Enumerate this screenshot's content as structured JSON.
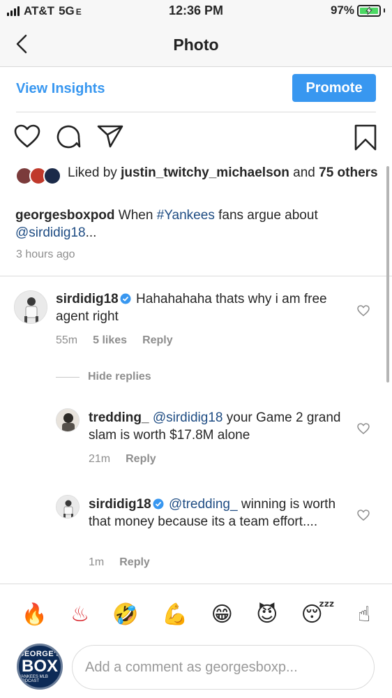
{
  "status_bar": {
    "carrier": "AT&T",
    "network": "5G",
    "network_suffix": "E",
    "time": "12:36 PM",
    "battery": "97%"
  },
  "nav": {
    "title": "Photo",
    "back_icon": "chevron-left-icon"
  },
  "insights": {
    "view_insights_label": "View Insights",
    "promote_label": "Promote"
  },
  "actions": {
    "icons": [
      "heart-icon",
      "comment-icon",
      "share-icon",
      "bookmark-icon"
    ]
  },
  "likes": {
    "prefix": "Liked by",
    "user": "justin_twitchy_michaelson",
    "joiner": "and",
    "others": "75 others"
  },
  "caption": {
    "user": "georgesboxpod",
    "text_1": "When",
    "hashtag": "#Yankees",
    "text_2": "fans argue about",
    "mention": "@sirdidig18",
    "text_3": "...",
    "time": "3 hours ago"
  },
  "comments": [
    {
      "user": "sirdidig18",
      "verified": true,
      "text": "Hahahahaha thats why i am free agent right",
      "time": "55m",
      "likes": "5 likes",
      "reply": "Reply"
    }
  ],
  "hide_replies_label": "Hide replies",
  "replies": [
    {
      "user": "tredding_",
      "verified": false,
      "mention": "@sirdidig18",
      "text": "your Game 2 grand slam is worth $17.8M alone",
      "time": "21m",
      "reply": "Reply"
    },
    {
      "user": "sirdidig18",
      "verified": true,
      "mention": "@tredding_",
      "text": "winning is worth that money because its a team effort....",
      "time": "1m",
      "reply": "Reply"
    }
  ],
  "emoji_bar": [
    "🔥",
    "♨",
    "🤣",
    "💪",
    "😁",
    "😈",
    "😴",
    "☝"
  ],
  "composer": {
    "avatar_line1": "GEORGE'S",
    "avatar_line2": "BOX",
    "avatar_line3": "YANKEES MLB PODCAST",
    "placeholder": "Add a comment as georgesboxp..."
  },
  "colors": {
    "accent": "#3897f0",
    "link": "#1e4c83",
    "muted": "#8e8e8e",
    "battery": "#4cd964"
  }
}
